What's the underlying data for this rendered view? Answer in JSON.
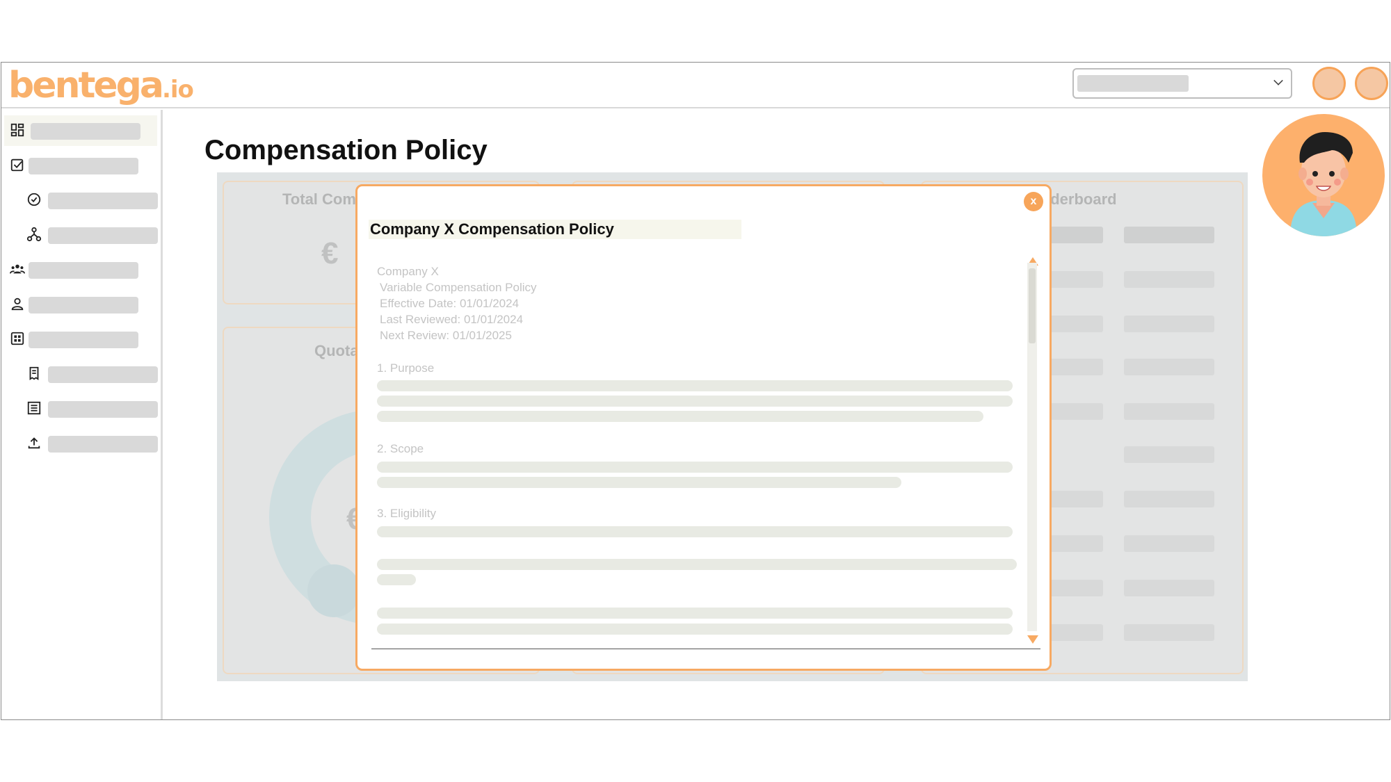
{
  "app": {
    "logo_main": "bentega",
    "logo_suffix": ".io"
  },
  "page": {
    "title": "Compensation Policy"
  },
  "dashboard": {
    "card_total_title": "Total Com",
    "card_total_symbol": "€",
    "card_quota_title": "Quota",
    "card_quota_symbol": "€",
    "card_leaderboard_title": "aderboard"
  },
  "modal": {
    "title": "Company X Compensation Policy",
    "close_label": "x",
    "doc": {
      "company": "Company X",
      "policy_name": "Variable Compensation Policy",
      "effective": "Effective Date: 01/01/2024",
      "reviewed": "Last Reviewed: 01/01/2024",
      "next_review": "Next Review: 01/01/2025",
      "section1": "1. Purpose",
      "section2": "2. Scope",
      "section3": "3. Eligibility"
    }
  },
  "icons": {
    "sidebar": [
      "dashboard-icon",
      "checkbox-icon",
      "verified-icon",
      "hierarchy-icon",
      "team-icon",
      "person-icon",
      "grid-icon",
      "receipt-icon",
      "list-icon",
      "upload-icon"
    ]
  },
  "colors": {
    "brand_orange": "#f9b16c",
    "accent_orange": "#f7a962",
    "placeholder_gray": "#d9d9d9"
  }
}
